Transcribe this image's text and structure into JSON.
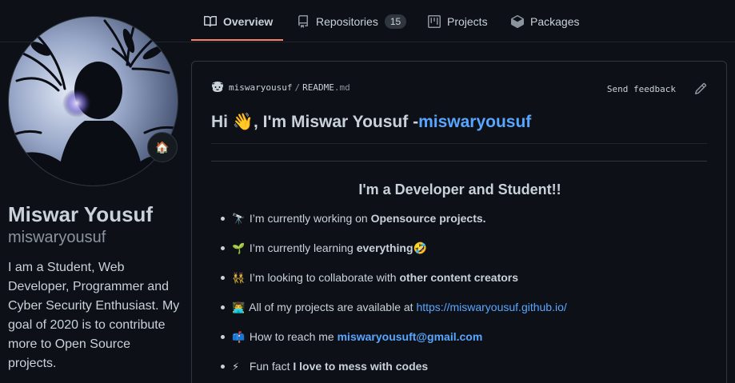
{
  "nav": {
    "tabs": [
      {
        "label": "Overview",
        "icon": "book-icon",
        "active": true
      },
      {
        "label": "Repositories",
        "icon": "repo-icon",
        "count": "15"
      },
      {
        "label": "Projects",
        "icon": "project-icon"
      },
      {
        "label": "Packages",
        "icon": "package-icon"
      }
    ]
  },
  "profile": {
    "status_emoji": "🏠",
    "name": "Miswar Yousuf",
    "username": "miswaryousuf",
    "bio": "I am a Student, Web Developer, Programmer and Cyber Security Enthusiast. My goal of 2020 is to contribute more to Open Source projects."
  },
  "readme": {
    "owner": "miswaryousuf",
    "separator": "/",
    "file_name": "README",
    "file_ext": ".md",
    "feedback_label": "Send feedback",
    "title_prefix": "Hi 👋, I'm Miswar Yousuf -",
    "title_link": "miswaryousuf",
    "subtitle": "I'm a Developer and Student!!",
    "items": [
      {
        "emoji": "🔭",
        "text": "I’m currently working on ",
        "strong": "Opensource projects."
      },
      {
        "emoji": "🌱",
        "text": "I’m currently learning ",
        "strong": "everything",
        "suffix": "🤣"
      },
      {
        "emoji": "👯",
        "text": "I’m looking to collaborate with ",
        "strong": "other content creators"
      },
      {
        "emoji": "👨‍💻",
        "text": "All of my projects are available at ",
        "link": "https://miswaryousuf.github.io/"
      },
      {
        "emoji": "📫",
        "text": "How to reach me ",
        "link": "miswaryousuft@gmail.com"
      },
      {
        "emoji": "⚡",
        "text": "Fun fact ",
        "strong": "I love to mess with codes"
      }
    ]
  },
  "colors": {
    "background": "#0d1117",
    "accent_underline": "#f78166",
    "link": "#58a6ff"
  }
}
